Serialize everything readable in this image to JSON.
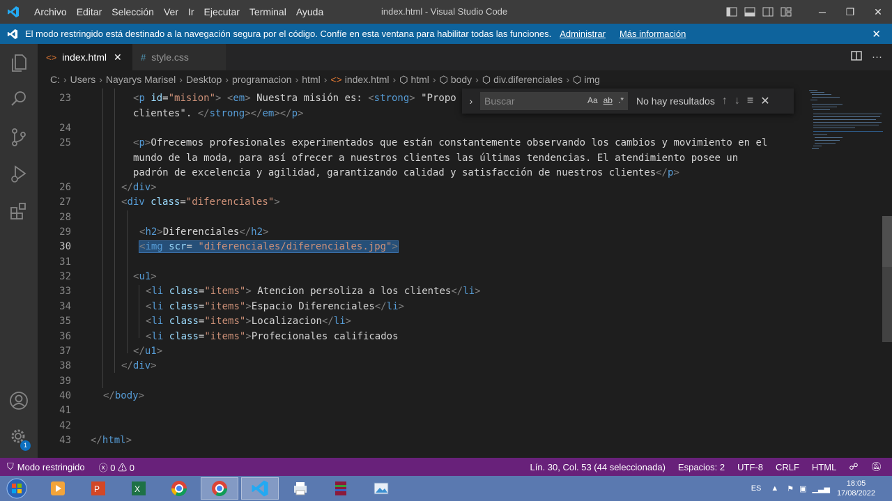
{
  "window": {
    "title": "index.html - Visual Studio Code",
    "menu": [
      "Archivo",
      "Editar",
      "Selección",
      "Ver",
      "Ir",
      "Ejecutar",
      "Terminal",
      "Ayuda"
    ],
    "controls": {
      "minimize": "─",
      "maximize": "❐",
      "close": "✕"
    }
  },
  "banner": {
    "text": "El modo restringido está destinado a la navegación segura por el código. Confíe en esta ventana para habilitar todas las funciones.",
    "link_manage": "Administrar",
    "link_more": "Más información",
    "close": "✕"
  },
  "tabs": [
    {
      "label": "index.html",
      "icon": "html-icon",
      "active": true,
      "close": "✕"
    },
    {
      "label": "style.css",
      "icon": "css-icon",
      "active": false
    }
  ],
  "breadcrumb": [
    "C:",
    "Users",
    "Nayarys Marisel",
    "Desktop",
    "programacion",
    "html",
    "index.html",
    "html",
    "body",
    "div.diferenciales",
    "img"
  ],
  "find": {
    "placeholder": "Buscar",
    "opt_case": "Aa",
    "opt_word": "ab",
    "opt_regex": ".*",
    "result": "No hay resultados"
  },
  "editor": {
    "line_numbers": [
      "23",
      "",
      "24",
      "25",
      "",
      "",
      "26",
      "27",
      "28",
      "29",
      "30",
      "31",
      "32",
      "33",
      "34",
      "35",
      "36",
      "37",
      "38",
      "39",
      "40",
      "41",
      "42",
      "43"
    ],
    "current_line": "30"
  },
  "statusbar": {
    "restricted": "Modo restringido",
    "errors": "0",
    "warnings": "0",
    "position": "Lín. 30, Col. 53 (44 seleccionada)",
    "spaces": "Espacios: 2",
    "encoding": "UTF-8",
    "eol": "CRLF",
    "language": "HTML"
  },
  "taskbar": {
    "lang": "ES",
    "time": "18:05",
    "date": "17/08/2022"
  },
  "accounts_badge": "1",
  "colors": {
    "statusbar": "#68217a",
    "banner": "#0e639c",
    "selection": "#264f78"
  }
}
